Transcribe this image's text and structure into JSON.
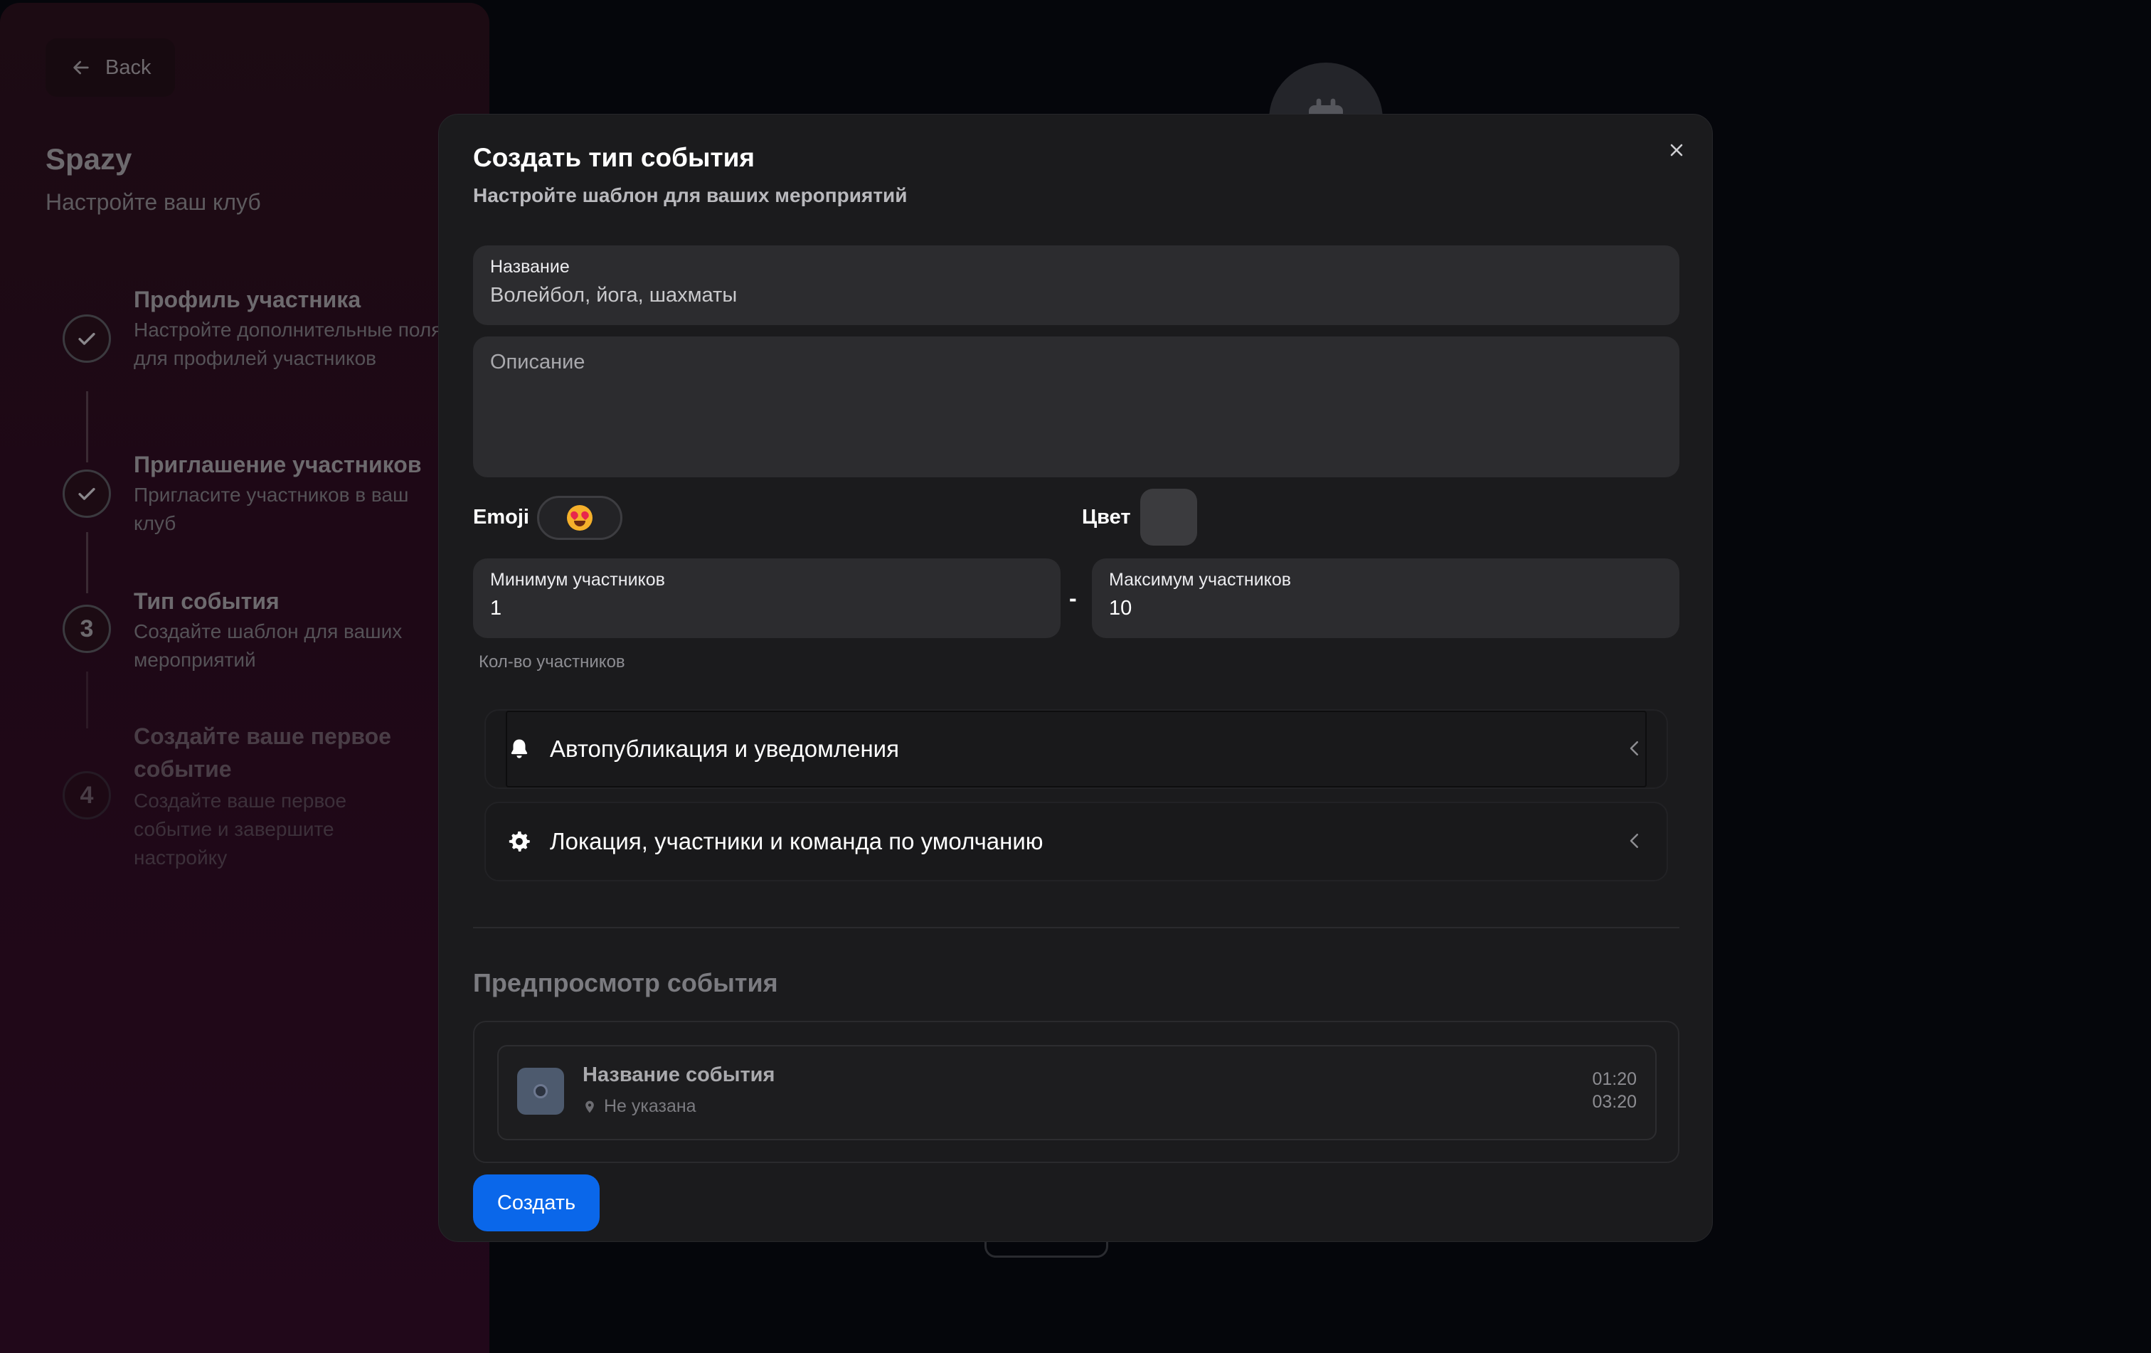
{
  "sidebar": {
    "back_label": "Back",
    "club_name": "Spazy",
    "club_subtitle": "Настройте ваш клуб",
    "steps": [
      {
        "number": "",
        "title": "Профиль участника",
        "description": "Настройте дополнительные поля для профилей участников",
        "status": "done"
      },
      {
        "number": "",
        "title": "Приглашение участников",
        "description": "Пригласите участников в ваш клуб",
        "status": "done"
      },
      {
        "number": "3",
        "title": "Тип события",
        "description": "Создайте шаблон для ваших мероприятий",
        "status": "current"
      },
      {
        "number": "4",
        "title": "Создайте ваше первое событие",
        "description": "Создайте ваше первое событие и завершите настройку",
        "status": "upcoming"
      }
    ]
  },
  "modal": {
    "title": "Создать тип события",
    "subtitle": "Настройте шаблон для ваших мероприятий",
    "name_field": {
      "label": "Название",
      "placeholder": "Волейбол, йога, шахматы"
    },
    "description_field": {
      "placeholder": "Описание"
    },
    "emoji_label": "Emoji",
    "emoji_value": "😍",
    "color_label": "Цвет",
    "color_value": "#3b3b3e",
    "min_field": {
      "label": "Минимум участников",
      "value": "1"
    },
    "separator": "-",
    "max_field": {
      "label": "Максимум участников",
      "value": "10"
    },
    "participants_helper": "Кол-во участников",
    "accordions": [
      {
        "label": "Автопубликация и уведомления",
        "icon": "bell-icon"
      },
      {
        "label": "Локация, участники и команда по умолчанию",
        "icon": "gear-icon"
      }
    ],
    "preview": {
      "title": "Предпросмотр события",
      "event_name": "Название события",
      "location": "Не указана",
      "start_time": "01:20",
      "end_time": "03:20"
    },
    "create_label": "Создать"
  },
  "colors": {
    "accent": "#0a67ea",
    "modal_bg": "#1b1b1d",
    "sidebar_bg": "#1e0816",
    "page_bg": "#05060b"
  }
}
